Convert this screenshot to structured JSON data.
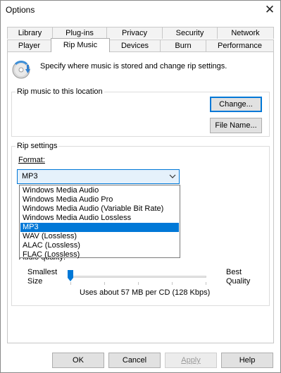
{
  "window": {
    "title": "Options"
  },
  "tabs_row1": [
    {
      "label": "Library"
    },
    {
      "label": "Plug-ins"
    },
    {
      "label": "Privacy"
    },
    {
      "label": "Security"
    },
    {
      "label": "Network"
    }
  ],
  "tabs_row2": [
    {
      "label": "Player"
    },
    {
      "label": "Rip Music",
      "active": true
    },
    {
      "label": "Devices"
    },
    {
      "label": "Burn"
    },
    {
      "label": "Performance"
    }
  ],
  "rip_music": {
    "description": "Specify where music is stored and change rip settings.",
    "location_group": {
      "title": "Rip music to this location",
      "change_button": "Change...",
      "file_name_button": "File Name..."
    },
    "settings_group": {
      "title": "Rip settings",
      "format_label": "Format:",
      "format_value": "MP3",
      "format_options": [
        "Windows Media Audio",
        "Windows Media Audio Pro",
        "Windows Media Audio (Variable Bit Rate)",
        "Windows Media Audio Lossless",
        "MP3",
        "WAV (Lossless)",
        "ALAC (Lossless)",
        "FLAC (Lossless)"
      ],
      "selected_option_index": 4,
      "audio_quality_label": "Audio quality:",
      "smallest_line1": "Smallest",
      "smallest_line2": "Size",
      "best_line1": "Best",
      "best_line2": "Quality",
      "quality_level": 0,
      "usage_text": "Uses about 57 MB per CD (128 Kbps)"
    }
  },
  "footer": {
    "ok": "OK",
    "cancel": "Cancel",
    "apply": "Apply",
    "help": "Help"
  },
  "colors": {
    "accent": "#0078d7",
    "button_face": "#e1e1e1",
    "disabled_text": "#9a9a9a"
  }
}
